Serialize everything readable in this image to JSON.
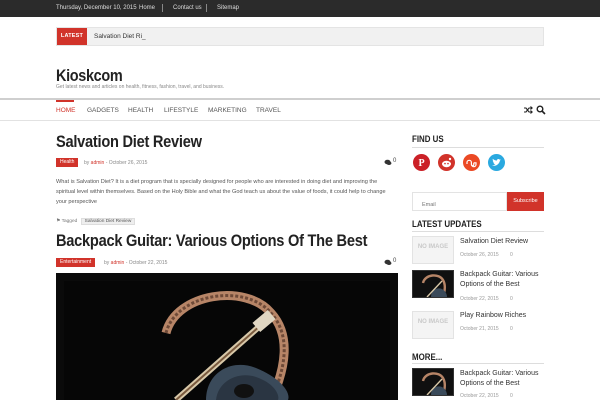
{
  "topbar": {
    "date": "Thursday, December 10, 2015",
    "links": [
      "Home",
      "Contact us",
      "Sitemap"
    ]
  },
  "ticker": {
    "label": "LATEST",
    "text": "Salvation Diet Ri_"
  },
  "site": {
    "name": "Kioskcom",
    "tagline": "Get latest news and articles on health, fitness, fashion, travel, and business."
  },
  "nav": {
    "items": [
      "HOME",
      "GADGETS",
      "HEALTH",
      "LIFESTYLE",
      "MARKETING",
      "TRAVEL"
    ],
    "icons": [
      "shuffle-icon",
      "search-icon"
    ]
  },
  "articles": [
    {
      "title": "Salvation Diet Review",
      "category": "Health",
      "by": "by",
      "author": "admin",
      "date": "- October 26, 2015",
      "comments": "0",
      "excerpt": "What is Salvation Diet? It is a diet program that is specially designed for people who are interested in doing diet and improving the spiritual level within themselves. Based on the Holy Bible and what the God teach us about the value of foods, it could help to change your perspective",
      "tags_label": "Tagged",
      "tags": [
        "Salvation Diet Review"
      ]
    },
    {
      "title": "Backpack Guitar: Various Options Of The Best",
      "category": "Entertainment",
      "by": "by",
      "author": "admin",
      "date": "- October 22, 2015",
      "comments": "0"
    }
  ],
  "sidebar": {
    "find_us": "FIND US",
    "social": [
      {
        "name": "pinterest-icon",
        "color": "#cb2027"
      },
      {
        "name": "reddit-icon",
        "color": "#d1332a"
      },
      {
        "name": "stumbleupon-icon",
        "color": "#eb4924"
      },
      {
        "name": "twitter-icon",
        "color": "#2aa9e0"
      }
    ],
    "email_placeholder": "Email",
    "subscribe": "Subscribe",
    "latest_updates": "LATEST UPDATES",
    "no_image": "NO IMAGE",
    "updates": [
      {
        "title": "Salvation Diet Review",
        "date": "October 26, 2015",
        "comments": "0"
      },
      {
        "title": "Backpack Guitar: Various Options of the Best",
        "date": "October 22, 2015",
        "comments": "0"
      },
      {
        "title": "Play Rainbow Riches",
        "date": "October 21, 2015",
        "comments": "0"
      }
    ],
    "more": "MORE...",
    "more_items": [
      {
        "title": "Backpack Guitar: Various Options of the Best",
        "date": "October 22, 2015",
        "comments": "0"
      }
    ]
  },
  "colors": {
    "accent": "#d1332a",
    "topbar": "#2b2b2b"
  }
}
